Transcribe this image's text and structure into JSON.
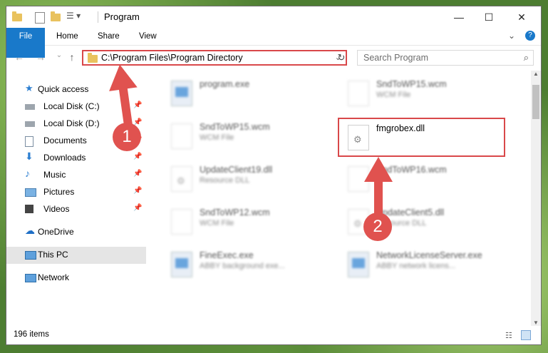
{
  "window": {
    "title": "Program"
  },
  "ribbon": {
    "tabs": [
      "File",
      "Home",
      "Share",
      "View"
    ]
  },
  "address": {
    "path": "C:\\Program Files\\Program Directory"
  },
  "search": {
    "placeholder": "Search Program"
  },
  "nav": {
    "items": [
      {
        "label": "Quick access"
      },
      {
        "label": "Local Disk (C:)"
      },
      {
        "label": "Local Disk (D:)"
      },
      {
        "label": "Documents"
      },
      {
        "label": "Downloads"
      },
      {
        "label": "Music"
      },
      {
        "label": "Pictures"
      },
      {
        "label": "Videos"
      },
      {
        "label": "OneDrive"
      },
      {
        "label": "This PC"
      },
      {
        "label": "Network"
      }
    ]
  },
  "files": [
    {
      "name": "program.exe",
      "desc": ""
    },
    {
      "name": "SndToWP15.wcm",
      "desc": "WCM File"
    },
    {
      "name": "SndToWP15.wcm",
      "desc": "WCM File"
    },
    {
      "name": "fmgrobex.dll",
      "desc": ""
    },
    {
      "name": "UpdateClient19.dll",
      "desc": "Resource DLL"
    },
    {
      "name": "SndToWP16.wcm",
      "desc": ""
    },
    {
      "name": "SndToWP12.wcm",
      "desc": "WCM File"
    },
    {
      "name": "UpdateClient5.dll",
      "desc": "Resource DLL"
    },
    {
      "name": "FineExec.exe",
      "desc": "ABBY background exe..."
    },
    {
      "name": "NetworkLicenseServer.exe",
      "desc": "ABBY network licens..."
    }
  ],
  "status": {
    "count": "196 items"
  },
  "annotations": [
    "1",
    "2"
  ],
  "colors": {
    "accent": "#1979ca",
    "highlight": "#d9484a",
    "badge": "#e0524f"
  }
}
